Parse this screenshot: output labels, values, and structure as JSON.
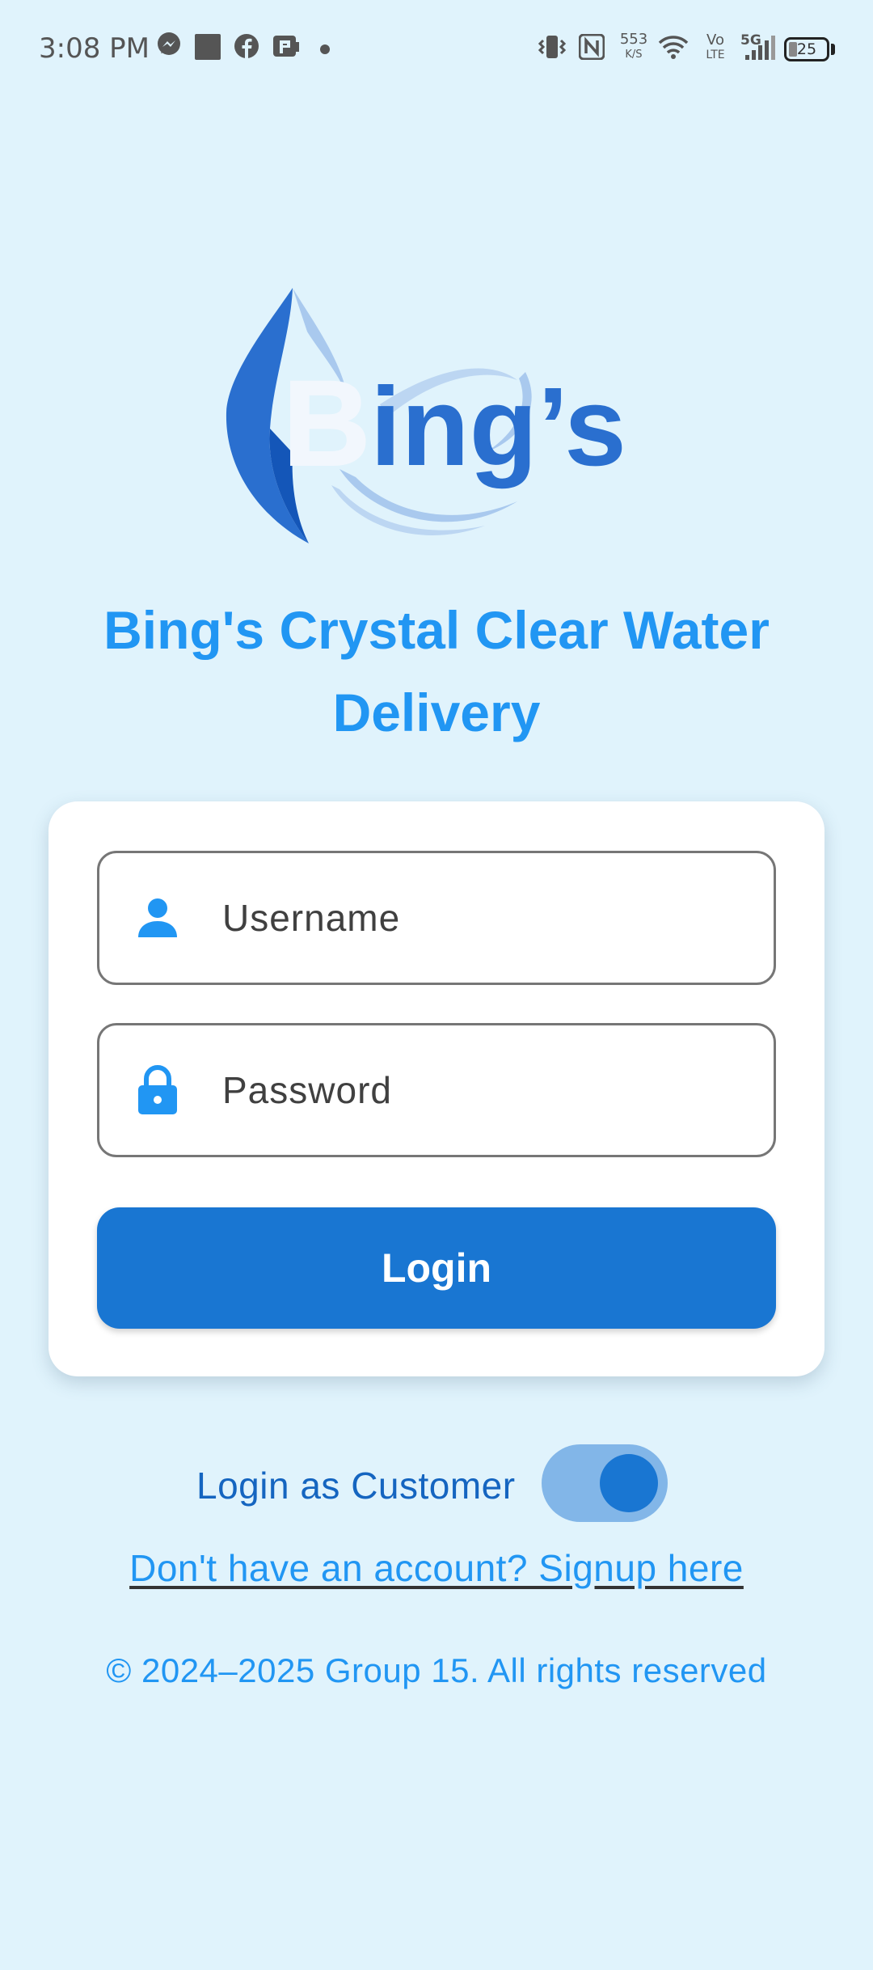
{
  "status_bar": {
    "time": "3:08 PM",
    "net_speed_value": "553",
    "net_speed_unit": "K/S",
    "volte_top": "Vo",
    "volte_bottom": "LTE",
    "network_type": "5G",
    "battery_level": "25",
    "icons": [
      "messenger-icon",
      "app-square-icon",
      "facebook-icon",
      "app-p-icon",
      "dot-icon",
      "vibrate-icon",
      "nfc-icon",
      "wifi-icon",
      "signal-icon",
      "battery-icon"
    ]
  },
  "logo": {
    "brand_text": "Bing's"
  },
  "header": {
    "title": "Bing's Crystal Clear Water Delivery"
  },
  "login_form": {
    "username_placeholder": "Username",
    "password_placeholder": "Password",
    "login_button_label": "Login"
  },
  "customer_toggle": {
    "label": "Login as Customer",
    "enabled": true
  },
  "signup": {
    "link_text": "Don't have an account? Signup here"
  },
  "footer": {
    "copyright": "© 2024–2025 Group 15. All rights reserved"
  },
  "colors": {
    "background": "#e0f3fc",
    "primary": "#1976d2",
    "accent": "#2196f3",
    "card": "#ffffff"
  }
}
